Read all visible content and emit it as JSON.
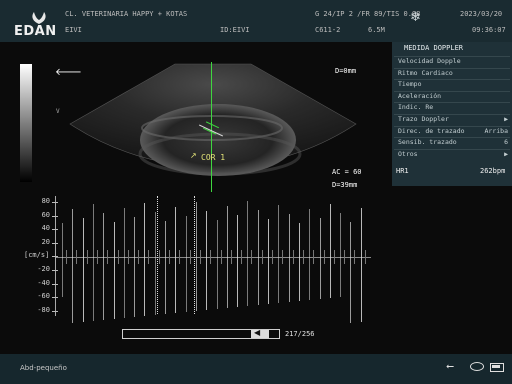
{
  "header": {
    "brand": "EDAN",
    "clinic": "CL. VETERINARIA HAPPY + KOTAS",
    "operator": "EIVI",
    "patient_id": "ID:EIVI",
    "params": "G 24/IP 2 /FR 89/TIS 0.08",
    "probe": "C611-2",
    "frequency": "6.5M",
    "date": "2023/03/20",
    "time": "09:36:07"
  },
  "image": {
    "depth_marker": "D=0mm",
    "cursor_label": "COR 1",
    "ac": "AC = 60",
    "depth": "D=39mm",
    "v_label": "V"
  },
  "doppler": {
    "y_ticks": [
      "80",
      "60",
      "40",
      "20",
      "[cm/s]",
      "-20",
      "-40",
      "-60",
      "-80"
    ],
    "scroll_counter": "217/256"
  },
  "measure_panel": {
    "title": "MEDIDA DOPPLER",
    "items": [
      {
        "label": "Velocidad Dopple",
        "value": ""
      },
      {
        "label": "Ritmo Cardiaco",
        "value": ""
      },
      {
        "label": "Tiempo",
        "value": ""
      },
      {
        "label": "Aceleración",
        "value": ""
      },
      {
        "label": "Indic. Re",
        "value": ""
      },
      {
        "label": "Trazo Doppler",
        "value": "▶"
      },
      {
        "label": "Direc. de trazado",
        "value": "Arriba"
      },
      {
        "label": "Sensib. trazado",
        "value": "6"
      },
      {
        "label": "Otros",
        "value": "▶"
      }
    ],
    "result_label": "HR1",
    "result_value": "262bpm"
  },
  "footer": {
    "preset": "Abd-pequeño"
  },
  "colors": {
    "topbar": "#1a2b31",
    "panel": "#1f3138",
    "cursor_line": "#3fd63f",
    "cursor_text": "#e6e67a"
  }
}
